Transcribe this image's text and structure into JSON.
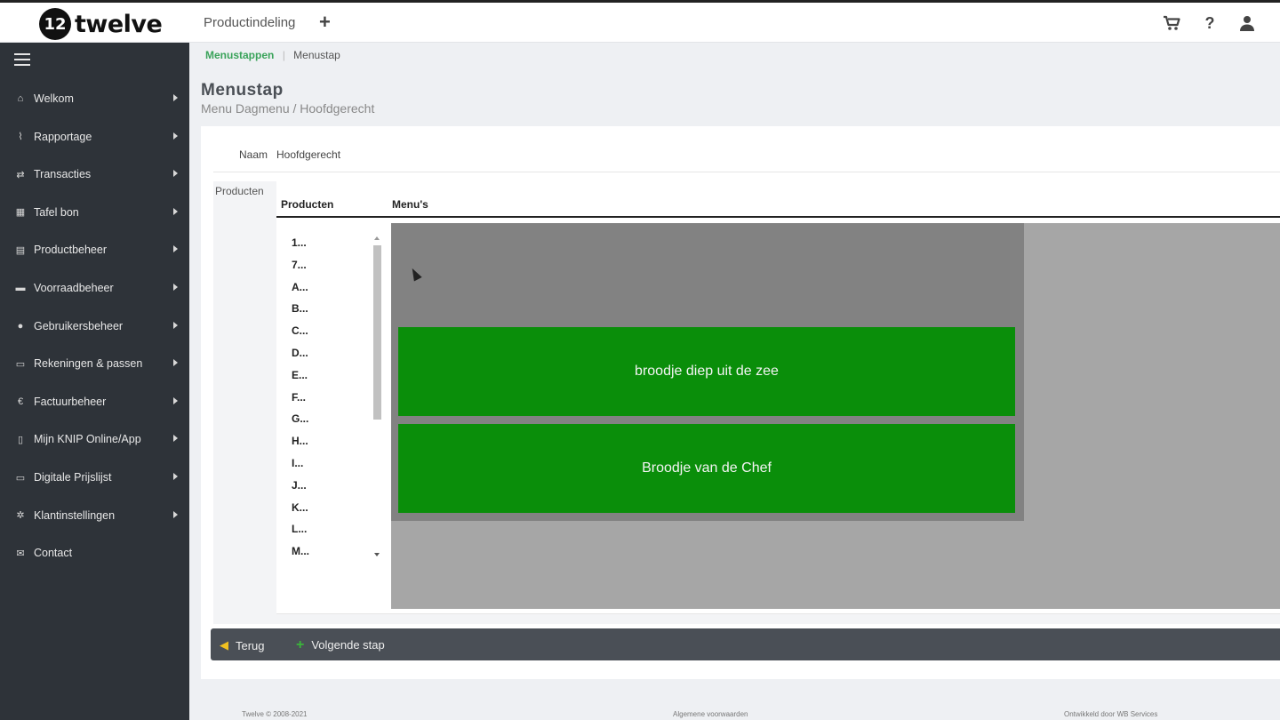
{
  "brand": {
    "logo_mark": "12",
    "name": "twelve"
  },
  "topbar": {
    "title": "Productindeling",
    "plus_label": "+",
    "icons": [
      "cart-icon",
      "help-icon",
      "user-icon"
    ],
    "help_label": "?"
  },
  "sidebar": {
    "items": [
      {
        "label": "Welkom",
        "icon": "home-icon",
        "glyph": "⌂"
      },
      {
        "label": "Rapportage",
        "icon": "chart-line-icon",
        "glyph": "⌇"
      },
      {
        "label": "Transacties",
        "icon": "exchange-icon",
        "glyph": "⇄"
      },
      {
        "label": "Tafel bon",
        "icon": "grid-icon",
        "glyph": "▦"
      },
      {
        "label": "Productbeheer",
        "icon": "basket-icon",
        "glyph": "▤"
      },
      {
        "label": "Voorraadbeheer",
        "icon": "truck-icon",
        "glyph": "▬"
      },
      {
        "label": "Gebruikersbeheer",
        "icon": "users-icon",
        "glyph": "●"
      },
      {
        "label": "Rekeningen & passen",
        "icon": "credit-card-icon",
        "glyph": "▭"
      },
      {
        "label": "Factuurbeheer",
        "icon": "euro-icon",
        "glyph": "€"
      },
      {
        "label": "Mijn KNIP Online/App",
        "icon": "mobile-icon",
        "glyph": "▯"
      },
      {
        "label": "Digitale Prijslijst",
        "icon": "monitor-icon",
        "glyph": "▭"
      },
      {
        "label": "Klantinstellingen",
        "icon": "cogs-icon",
        "glyph": "✲"
      },
      {
        "label": "Contact",
        "icon": "envelope-icon",
        "glyph": "✉"
      }
    ]
  },
  "breadcrumb": {
    "parent": "Menustappen",
    "separator": "|",
    "current": "Menustap"
  },
  "page": {
    "title": "Menustap",
    "subtitle": "Menu Dagmenu / Hoofdgerecht"
  },
  "form": {
    "naam_label": "Naam",
    "naam_value": "Hoofdgerecht",
    "producten_label": "Producten"
  },
  "table": {
    "col_products": "Producten",
    "col_menus": "Menu's",
    "letters": [
      "1...",
      "7...",
      "A...",
      "B...",
      "C...",
      "D...",
      "E...",
      "F...",
      "G...",
      "H...",
      "I...",
      "J...",
      "K...",
      "L...",
      "M..."
    ],
    "menus": [
      "broodje diep uit de zee",
      "Broodje van de Chef"
    ]
  },
  "actions": {
    "back_label": "Terug",
    "next_label": "Volgende stap"
  },
  "footer": {
    "copyright": "Twelve © 2008-2021",
    "terms": "Algemene voorwaarden",
    "developer": "Ontwikkeld door WB Services"
  },
  "colors": {
    "sidebar_bg": "#2e3339",
    "accent_green": "#3aa35a",
    "menu_tile_green": "#0a8e0a",
    "actionbar_bg": "#4a4f56"
  }
}
